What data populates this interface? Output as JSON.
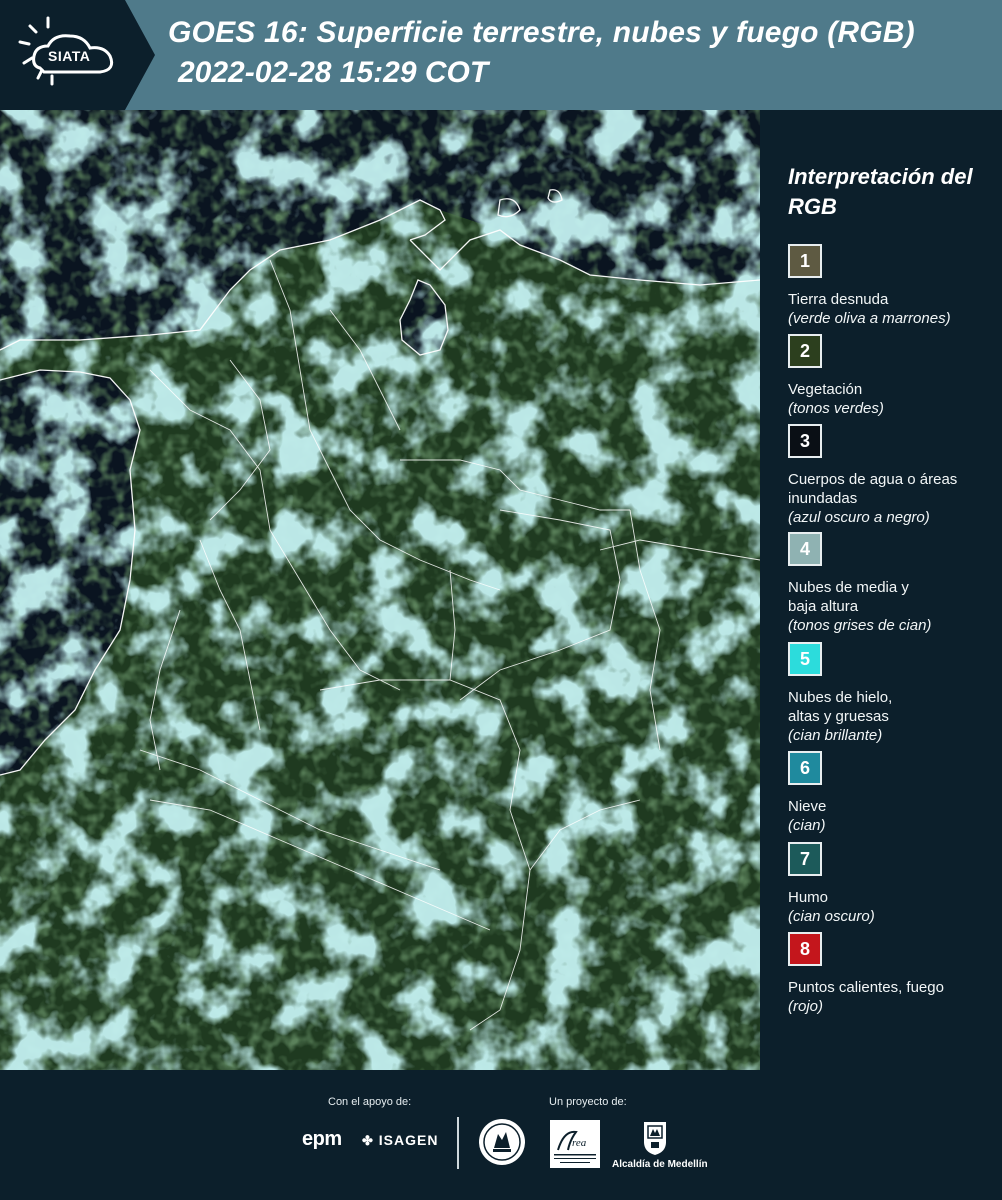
{
  "header": {
    "logo_text": "SIATA",
    "title_line1": "GOES 16: Superficie terrestre, nubes y fuego (RGB)",
    "title_line2": "2022-02-28 15:29 COT"
  },
  "legend": {
    "title": "Interpretación del RGB",
    "items": [
      {
        "number": "1",
        "label": "Tierra desnuda",
        "note": "(verde oliva a marrones)",
        "color": "#5e5a42"
      },
      {
        "number": "2",
        "label": "Vegetación",
        "note": "(tonos verdes)",
        "color": "#2c3f1e"
      },
      {
        "number": "3",
        "label": "Cuerpos de agua o áreas inundadas",
        "note": "(azul oscuro a negro)",
        "color": "#0a0f15"
      },
      {
        "number": "4",
        "label": "Nubes de media y baja altura",
        "note": "(tonos grises de cian)",
        "color": "#8fb2b2"
      },
      {
        "number": "5",
        "label": "Nubes de hielo, altas y gruesas",
        "note": "(cian brillante)",
        "color": "#2cdcdc"
      },
      {
        "number": "6",
        "label": "Nieve",
        "note": "(cian)",
        "color": "#1f8a9e"
      },
      {
        "number": "7",
        "label": "Humo",
        "note": "(cian oscuro)",
        "color": "#1c5a5a"
      },
      {
        "number": "8",
        "label": "Puntos calientes, fuego",
        "note": "(rojo)",
        "color": "#c4161c"
      }
    ]
  },
  "footer": {
    "support_label": "Con el apoyo de:",
    "project_label": "Un proyecto de:",
    "sponsor_1": "epm",
    "sponsor_2": "ISAGEN",
    "partner_1": "Área Metropolitana Valle de Aburrá",
    "partner_2": "Alcaldía de Medellín"
  },
  "colors": {
    "header_bg": "#4f7a8a",
    "panel_bg": "#0c1f2b",
    "ocean": "#0a1420",
    "vegetation": "#233a20",
    "cloud": "#7fd6d6"
  }
}
